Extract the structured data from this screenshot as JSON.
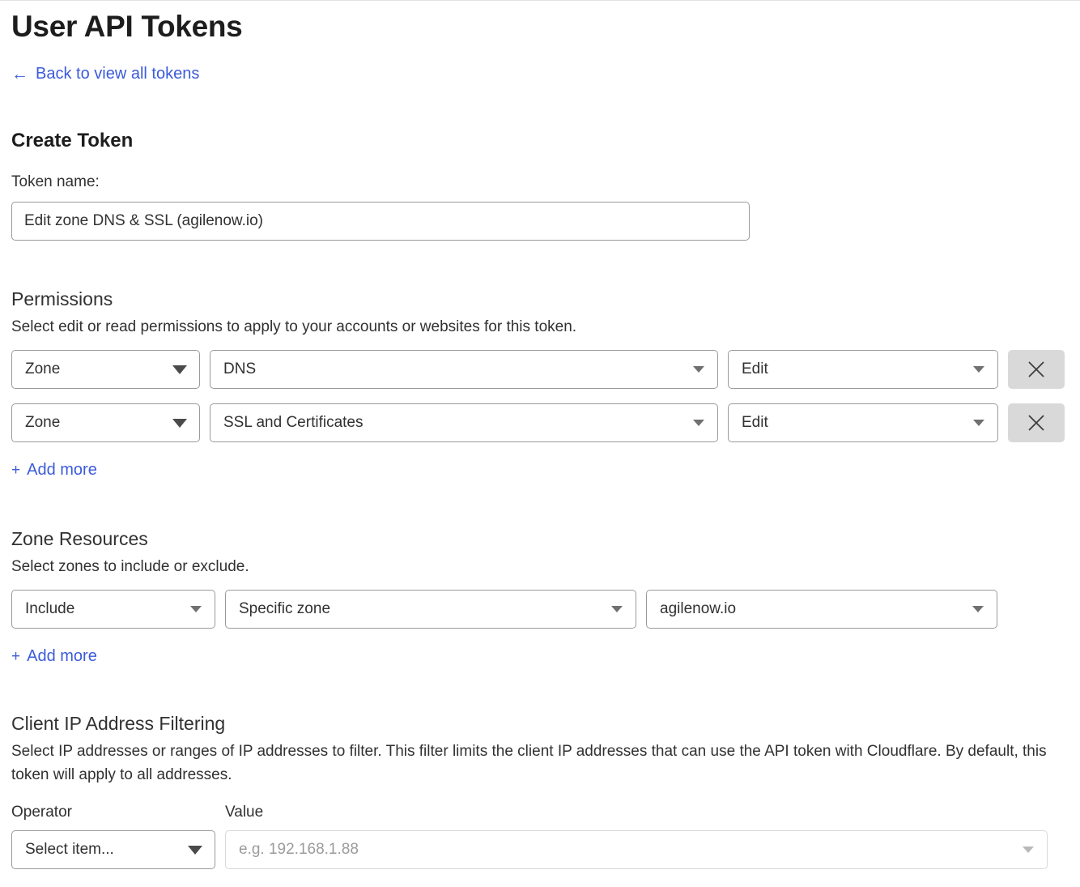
{
  "header": {
    "title": "User API Tokens",
    "back_link": "Back to view all tokens",
    "back_arrow_icon": "arrow-left-icon"
  },
  "create_token": {
    "heading": "Create Token",
    "token_name_label": "Token name:",
    "token_name_value": "Edit zone DNS & SSL (agilenow.io)"
  },
  "permissions": {
    "heading": "Permissions",
    "description": "Select edit or read permissions to apply to your accounts or websites for this token.",
    "rows": [
      {
        "scope": "Zone",
        "resource": "DNS",
        "access": "Edit",
        "remove_icon": "close-icon"
      },
      {
        "scope": "Zone",
        "resource": "SSL and Certificates",
        "access": "Edit",
        "remove_icon": "close-icon"
      }
    ],
    "add_more_label": "Add more",
    "add_more_plus": "+"
  },
  "zone_resources": {
    "heading": "Zone Resources",
    "description": "Select zones to include or exclude.",
    "rows": [
      {
        "inclusion": "Include",
        "scope": "Specific zone",
        "target": "agilenow.io"
      }
    ],
    "add_more_label": "Add more",
    "add_more_plus": "+"
  },
  "client_ip_filtering": {
    "heading": "Client IP Address Filtering",
    "description": "Select IP addresses or ranges of IP addresses to filter. This filter limits the client IP addresses that can use the API token with Cloudflare. By default, this token will apply to all addresses.",
    "operator_label": "Operator",
    "operator_value": "Select item...",
    "value_label": "Value",
    "value_placeholder": "e.g. 192.168.1.88"
  },
  "colors": {
    "link": "#3b5bdb",
    "text": "#313131",
    "heading": "#1d1d1d",
    "border": "#9a9a9a",
    "remove_button_bg": "#d9d9d9"
  }
}
